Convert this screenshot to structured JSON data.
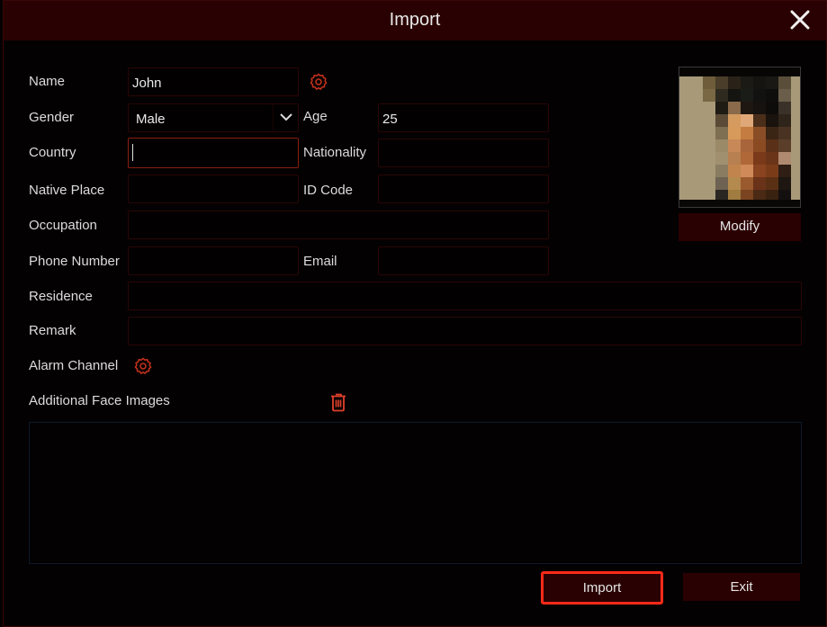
{
  "dialog": {
    "title": "Import",
    "close_icon": "close-icon"
  },
  "form": {
    "name": {
      "label": "Name",
      "value": "John"
    },
    "gender": {
      "label": "Gender",
      "value": "Male"
    },
    "age": {
      "label": "Age",
      "value": "25"
    },
    "country": {
      "label": "Country",
      "value": ""
    },
    "nationality": {
      "label": "Nationality",
      "value": ""
    },
    "native_place": {
      "label": "Native Place",
      "value": ""
    },
    "id_code": {
      "label": "ID Code",
      "value": ""
    },
    "occupation": {
      "label": "Occupation",
      "value": ""
    },
    "phone_number": {
      "label": "Phone Number",
      "value": ""
    },
    "email": {
      "label": "Email",
      "value": ""
    },
    "residence": {
      "label": "Residence",
      "value": ""
    },
    "remark": {
      "label": "Remark",
      "value": ""
    },
    "alarm_channel": {
      "label": "Alarm Channel"
    },
    "additional_face_images": {
      "label": "Additional Face Images"
    }
  },
  "photo": {
    "modify_label": "Modify"
  },
  "footer": {
    "import_label": "Import",
    "exit_label": "Exit"
  },
  "colors": {
    "accent": "#ff2a1a",
    "titlebar": "#2a0102",
    "icon_red": "#c0301c"
  }
}
